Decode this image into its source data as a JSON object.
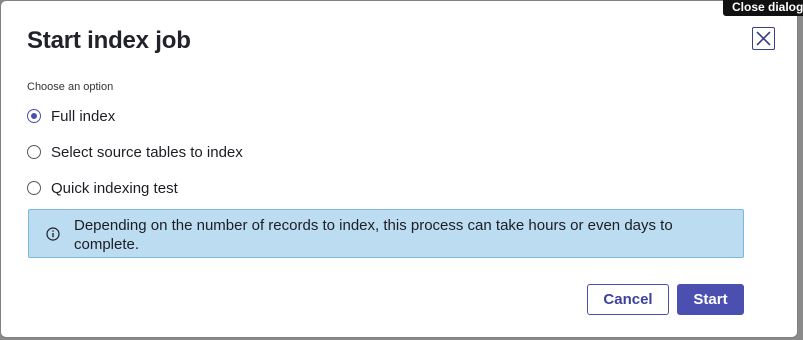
{
  "dialog": {
    "title": "Start index job",
    "close_tooltip": "Close dialog",
    "close_icon": "close-icon"
  },
  "options_group": {
    "label": "Choose an option",
    "selected": "Full index",
    "options": [
      {
        "label": "Full index",
        "checked": true
      },
      {
        "label": "Select source tables to index",
        "checked": false
      },
      {
        "label": "Quick indexing test",
        "checked": false
      }
    ]
  },
  "info_banner": {
    "icon": "info-icon",
    "text": "Depending on the number of records to index, this process can take hours or even days to complete."
  },
  "footer": {
    "cancel_label": "Cancel",
    "start_label": "Start"
  },
  "colors": {
    "accent": "#4b4fb0",
    "info_background": "#bcdcf1",
    "info_border": "#7fb6dc",
    "title": "#22222a"
  }
}
